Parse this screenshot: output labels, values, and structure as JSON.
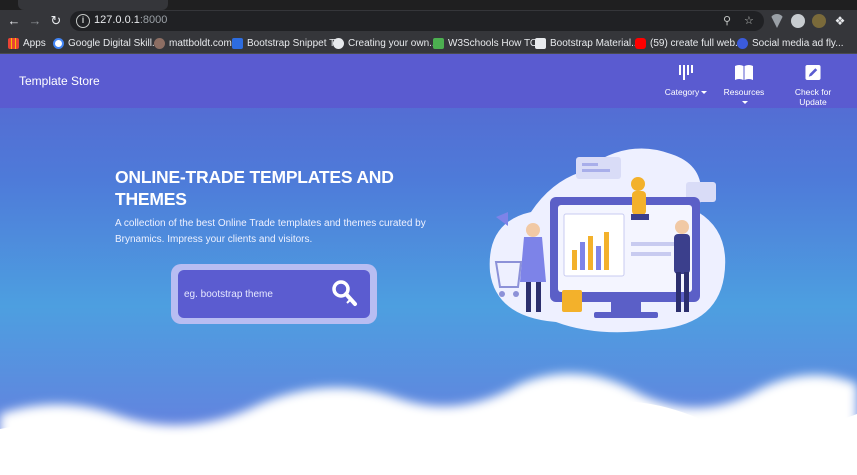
{
  "browser": {
    "url_host": "127.0.0.1",
    "url_port": ":8000"
  },
  "bookmarks": [
    {
      "label": "Apps",
      "color": "#ea4335"
    },
    {
      "label": "Google Digital Skill...",
      "color": "#4285f4"
    },
    {
      "label": "mattboldt.com",
      "color": "#8d6e63"
    },
    {
      "label": "Bootstrap Snippet T...",
      "color": "#2d6cdf"
    },
    {
      "label": "Creating your own...",
      "color": "#9aa0a6"
    },
    {
      "label": "W3Schools How TO...",
      "color": "#4caf50"
    },
    {
      "label": "Bootstrap Material...",
      "color": "#e8eaed"
    },
    {
      "label": "(59) create full web...",
      "color": "#ff0000"
    },
    {
      "label": "Social media ad fly...",
      "color": "#3b5bdb"
    }
  ],
  "navbar": {
    "brand": "Template Store",
    "items": [
      {
        "label": "Category",
        "icon": "bars-icon",
        "dropdown": true
      },
      {
        "label": "Resources",
        "icon": "book-icon",
        "dropdown": true
      },
      {
        "label": "Check for Update",
        "icon": "edit-icon",
        "dropdown": false
      }
    ]
  },
  "hero": {
    "title": "ONLINE-TRADE TEMPLATES AND THEMES",
    "description": "A collection of the best Online Trade templates and themes curated by Brynamics. Impress your clients and visitors."
  },
  "search": {
    "placeholder": "eg. bootstrap theme"
  },
  "colors": {
    "navbar": "#5a5bd0",
    "search_box": "#5b5cd0",
    "search_frame": "#b8bdf2"
  }
}
